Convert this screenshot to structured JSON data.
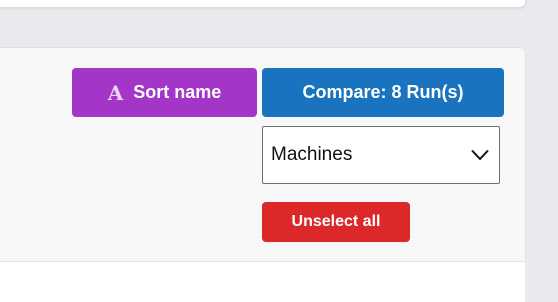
{
  "toolbar": {
    "sort_icon_glyph": "A",
    "sort_label": "Sort name",
    "compare_label": "Compare: 8 Run(s)",
    "unselect_label": "Unselect all"
  },
  "group_by_select": {
    "value": "Machines"
  },
  "colors": {
    "sort_button": "#a335c9",
    "compare_button": "#1a73be",
    "unselect_button": "#dc2828",
    "page_background": "#e9eaed"
  },
  "icons": {
    "sort": "sort-alpha-icon",
    "dropdown": "chevron-down-icon"
  }
}
